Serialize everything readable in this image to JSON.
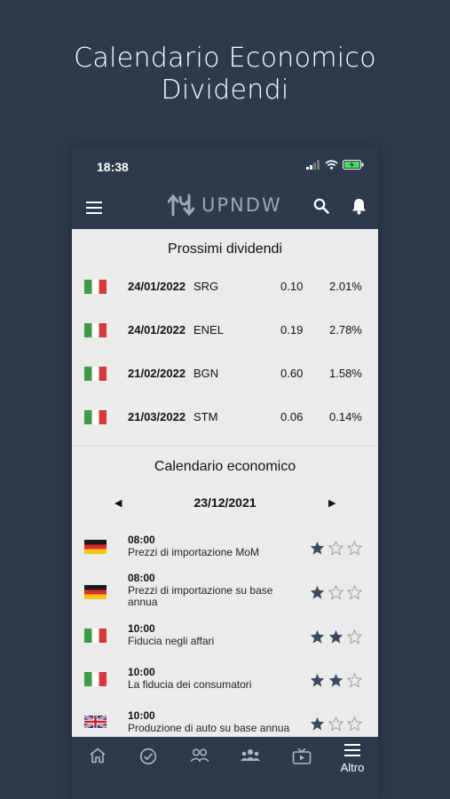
{
  "headline": {
    "line1": "Calendario Economico",
    "line2": "Dividendi"
  },
  "status": {
    "time": "18:38"
  },
  "appbar": {
    "logo_text": "UPNDW"
  },
  "dividends": {
    "title": "Prossimi dividendi",
    "rows": [
      {
        "flag": "it-flag",
        "date": "24/01/2022",
        "symbol": "SRG",
        "amount": "0.10",
        "yield": "2.01%"
      },
      {
        "flag": "it-flag",
        "date": "24/01/2022",
        "symbol": "ENEL",
        "amount": "0.19",
        "yield": "2.78%"
      },
      {
        "flag": "it-flag",
        "date": "21/02/2022",
        "symbol": "BGN",
        "amount": "0.60",
        "yield": "1.58%"
      },
      {
        "flag": "it-flag",
        "date": "21/03/2022",
        "symbol": "STM",
        "amount": "0.06",
        "yield": "0.14%"
      }
    ]
  },
  "calendar": {
    "title": "Calendario economico",
    "date": "23/12/2021",
    "events": [
      {
        "flag": "de-flag",
        "time": "08:00",
        "name": "Prezzi di importazione MoM",
        "importance": 1
      },
      {
        "flag": "de-flag",
        "time": "08:00",
        "name": "Prezzi di importazione su base annua",
        "importance": 1
      },
      {
        "flag": "it-flag",
        "time": "10:00",
        "name": "Fiducia negli affari",
        "importance": 2
      },
      {
        "flag": "it-flag",
        "time": "10:00",
        "name": "La fiducia dei consumatori",
        "importance": 2
      },
      {
        "flag": "uk-flag",
        "time": "10:00",
        "name": "Produzione di auto su base annua",
        "importance": 1
      }
    ]
  },
  "tabbar": {
    "more_label": "Altro"
  },
  "colors": {
    "background": "#2c3a4c",
    "content": "#ebebea",
    "star_filled": "#3b4a5c",
    "star_empty": "#9aa4ae"
  }
}
